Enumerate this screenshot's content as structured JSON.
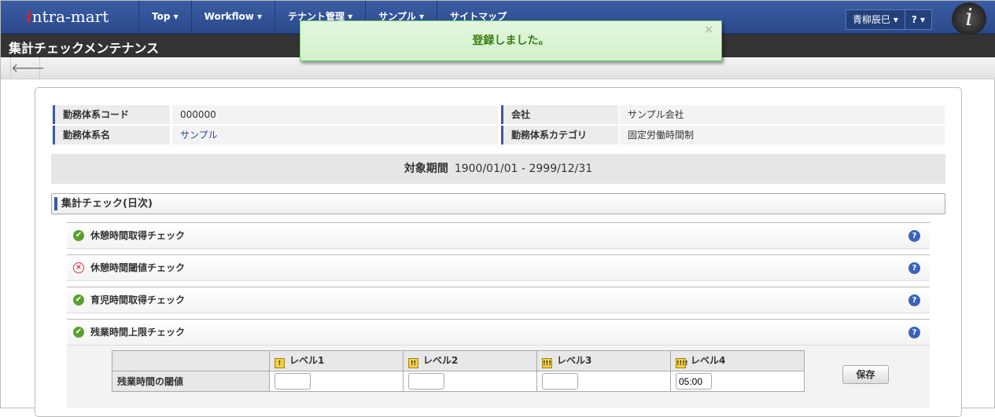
{
  "nav": {
    "logo": "intra-mart",
    "items": [
      "Top ▾",
      "Workflow ▾",
      "テナント管理 ▾",
      "サンプル ▾",
      "サイトマップ"
    ],
    "user": "青柳辰巳 ▾",
    "help": "? ▾"
  },
  "title": "集計チェックメンテナンス",
  "notice": {
    "message": "登録しました。",
    "close": "×"
  },
  "info": {
    "code_label": "勤務体系コード",
    "code": "000000",
    "company_label": "会社",
    "company": "サンプル会社",
    "name_label": "勤務体系名",
    "name": "サンプル",
    "category_label": "勤務体系カテゴリ",
    "category": "固定労働時間制"
  },
  "period": {
    "label": "対象期間",
    "value": "1900/01/01 - 2999/12/31"
  },
  "section": "集計チェック(日次)",
  "checks": [
    {
      "label": "休憩時間取得チェック",
      "status": "ok"
    },
    {
      "label": "休憩時間閾値チェック",
      "status": "error"
    },
    {
      "label": "育児時間取得チェック",
      "status": "ok"
    },
    {
      "label": "残業時間上限チェック",
      "status": "ok"
    }
  ],
  "threshold": {
    "row_label": "残業時間の閾値",
    "levels": [
      {
        "label": "レベル1",
        "icon": "!",
        "value": ""
      },
      {
        "label": "レベル2",
        "icon": "!!",
        "value": ""
      },
      {
        "label": "レベル3",
        "icon": "!!!",
        "value": ""
      },
      {
        "label": "レベル4",
        "icon": "!!!!",
        "value": "05:00"
      }
    ],
    "save": "保存"
  }
}
